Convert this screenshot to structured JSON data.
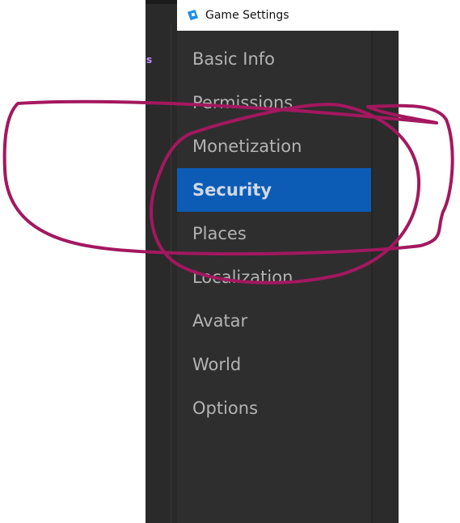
{
  "background_window": {
    "label_fragment": "s"
  },
  "window": {
    "title": "Game Settings",
    "logo_icon": "roblox-studio-logo-icon"
  },
  "sidebar": {
    "selected_index": 3,
    "items": [
      {
        "label": "Basic Info"
      },
      {
        "label": "Permissions"
      },
      {
        "label": "Monetization"
      },
      {
        "label": "Security"
      },
      {
        "label": "Places"
      },
      {
        "label": "Localization"
      },
      {
        "label": "Avatar"
      },
      {
        "label": "World"
      },
      {
        "label": "Options"
      }
    ]
  },
  "colors": {
    "selected_item": "#0c5cb5",
    "sidebar_background": "#2e2e2e",
    "annotation_ink": "#a3185f"
  }
}
